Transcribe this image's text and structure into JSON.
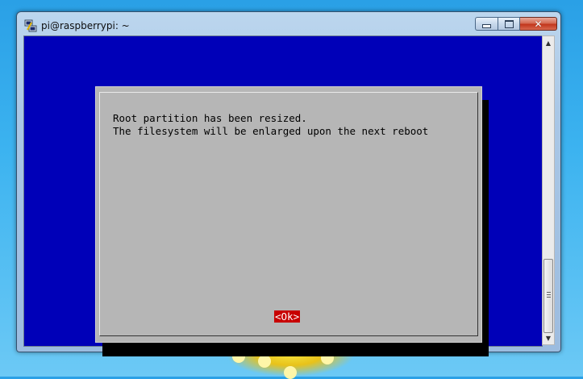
{
  "window": {
    "title": "pi@raspberrypi: ~",
    "icons": {
      "app": "putty-icon",
      "minimize": "minimize-icon",
      "maximize": "maximize-icon",
      "close": "close-icon"
    },
    "close_glyph": "✕"
  },
  "dialog": {
    "line1": "Root partition has been resized.",
    "line2": "The filesystem will be enlarged upon the next reboot",
    "ok_label": "<Ok>"
  },
  "colors": {
    "console_background": "#0000b8",
    "dialog_background": "#b6b6b6",
    "ok_button": "#c80000"
  }
}
